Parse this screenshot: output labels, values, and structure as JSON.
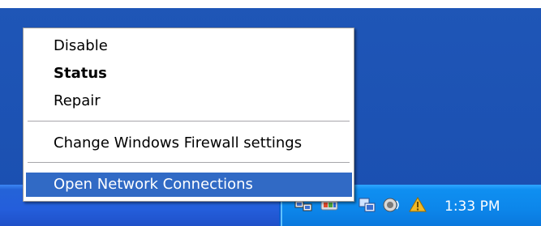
{
  "context_menu": {
    "items": [
      {
        "label": "Disable"
      },
      {
        "label": "Status"
      },
      {
        "label": "Repair"
      },
      {
        "label": "Change Windows Firewall settings"
      },
      {
        "label": "Open Network Connections"
      }
    ]
  },
  "taskbar": {
    "tray_icons": [
      "network-connection-icon",
      "security-center-icon",
      "network-shield-icon",
      "volume-icon",
      "updates-icon"
    ],
    "clock": "1:33 PM"
  },
  "colors": {
    "desktop_blue": "#1f56b7",
    "tray_blue": "#0c86ea",
    "highlight": "#316ac5"
  }
}
